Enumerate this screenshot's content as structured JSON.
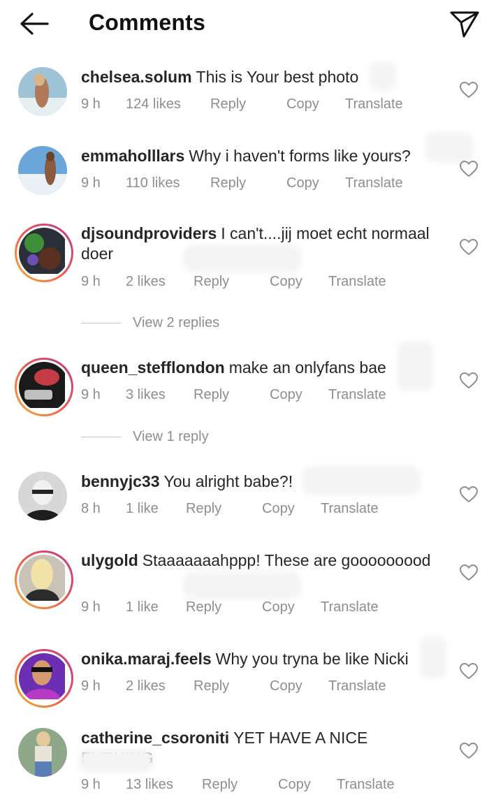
{
  "header": {
    "title": "Comments",
    "back_icon": "arrow-left-icon",
    "send_icon": "paper-plane-icon"
  },
  "comments": [
    {
      "username": "chelsea.solum",
      "text": "This is Your best photo",
      "time": "9 h",
      "likes": "124 likes",
      "reply": "Reply",
      "copy": "Copy",
      "translate": "Translate"
    },
    {
      "username": "emmaholllars",
      "text": "Why i haven't forms like yours?",
      "time": "9 h",
      "likes": "110 likes",
      "reply": "Reply",
      "copy": "Copy",
      "translate": "Translate"
    },
    {
      "username": "djsoundproviders",
      "text": "I can't....jij  moet echt normaal doer",
      "time": "9 h",
      "likes": "2 likes",
      "reply": "Reply",
      "copy": "Copy",
      "translate": "Translate",
      "view_replies": "View 2 replies"
    },
    {
      "username": "queen_stefflondon",
      "text": "make an onlyfans bae",
      "time": "9 h",
      "likes": "3 likes",
      "reply": "Reply",
      "copy": "Copy",
      "translate": "Translate",
      "view_replies": "View 1 reply"
    },
    {
      "username": "bennyjc33",
      "text": "You alright babe?!",
      "time": "8 h",
      "likes": "1 like",
      "reply": "Reply",
      "copy": "Copy",
      "translate": "Translate"
    },
    {
      "username": "ulygold",
      "text": "Staaaaaaahppp! These are gooooooood",
      "time": "9 h",
      "likes": "1 like",
      "reply": "Reply",
      "copy": "Copy",
      "translate": "Translate"
    },
    {
      "username": "onika.maraj.feels",
      "text": "Why you tryna be like Nicki",
      "time": "9 h",
      "likes": "2 likes",
      "reply": "Reply",
      "copy": "Copy",
      "translate": "Translate"
    },
    {
      "username": "catherine_csoroniti",
      "text": "YET HAVE A NICE EVENING",
      "time": "9 h",
      "likes": "13 likes",
      "reply": "Reply",
      "copy": "Copy",
      "translate": "Translate"
    }
  ]
}
